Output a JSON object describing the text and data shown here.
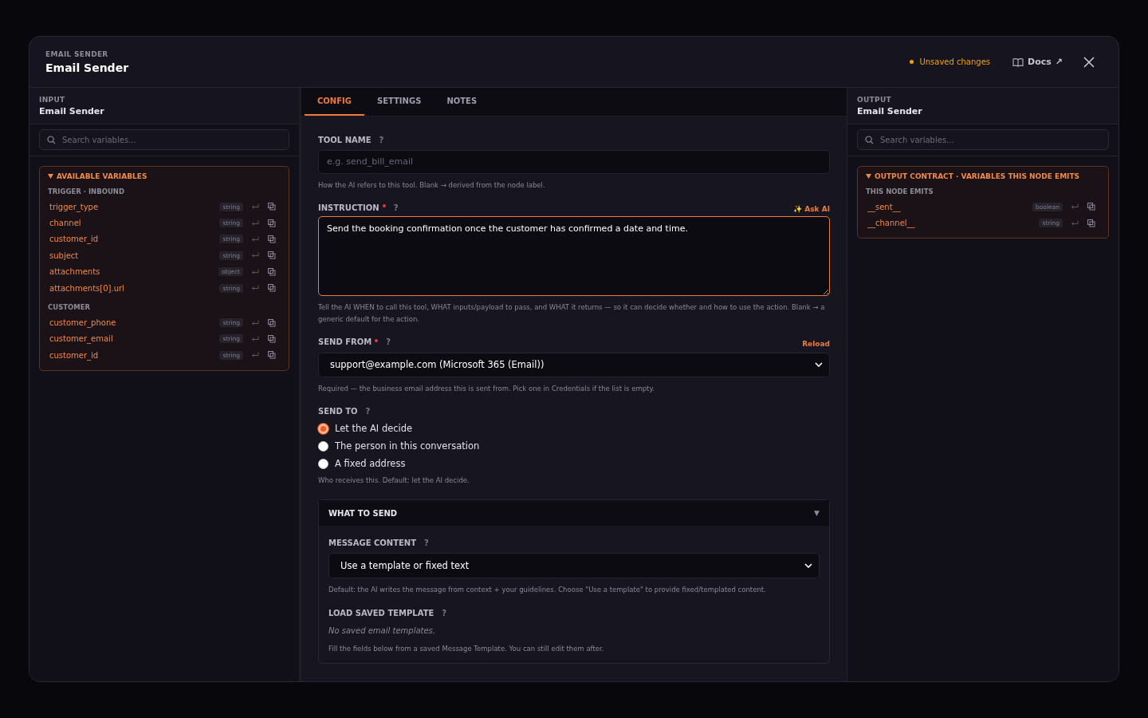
{
  "header": {
    "eyebrow": "EMAIL SENDER",
    "title": "Email Sender",
    "unsaved": "Unsaved changes",
    "docs": {
      "label": "Docs",
      "arrow": "↗"
    }
  },
  "input_panel": {
    "eyebrow": "INPUT",
    "title": "Email Sender",
    "search": {
      "placeholder": "Search variables..."
    },
    "section": {
      "title": "AVAILABLE VARIABLES",
      "expanded": true,
      "groups": [
        {
          "label": "TRIGGER · INBOUND",
          "vars": [
            {
              "name": "trigger_type",
              "type": "string"
            },
            {
              "name": "channel",
              "type": "string"
            },
            {
              "name": "customer_id",
              "type": "string"
            },
            {
              "name": "subject",
              "type": "string"
            },
            {
              "name": "attachments",
              "type": "object"
            },
            {
              "name": "attachments[0].url",
              "type": "string"
            }
          ]
        },
        {
          "label": "CUSTOMER",
          "vars": [
            {
              "name": "customer_phone",
              "type": "string"
            },
            {
              "name": "customer_email",
              "type": "string"
            },
            {
              "name": "customer_id",
              "type": "string"
            }
          ]
        }
      ]
    }
  },
  "tabs": [
    {
      "label": "CONFIG",
      "selected": true
    },
    {
      "label": "SETTINGS",
      "selected": false
    },
    {
      "label": "NOTES",
      "selected": false
    }
  ],
  "config": {
    "tool_name": {
      "label": "TOOL NAME",
      "help": "?",
      "placeholder": "e.g. send_bill_email",
      "hint": "How the AI refers to this tool. Blank → derived from the node label."
    },
    "instruction": {
      "label": "INSTRUCTION",
      "required": true,
      "help": "?",
      "ask_ai": "✨ Ask AI",
      "value": "Send the booking confirmation once the customer has confirmed a date and time.",
      "hint": "Tell the AI WHEN to call this tool, WHAT inputs/payload to pass, and WHAT it returns — so it can decide whether and how to use the action. Blank → a generic default for the action."
    },
    "send_from": {
      "label": "SEND FROM",
      "required": true,
      "help": "?",
      "reload": "Reload",
      "value": "support@example.com (Microsoft 365 (Email))",
      "hint": "Required — the business email address this is sent from. Pick one in Credentials if the list is empty."
    },
    "send_to": {
      "label": "SEND TO",
      "help": "?",
      "options": [
        {
          "label": "Let the AI decide",
          "selected": true
        },
        {
          "label": "The person in this conversation",
          "selected": false
        },
        {
          "label": "A fixed address",
          "selected": false
        }
      ],
      "hint": "Who receives this. Default: let the AI decide."
    },
    "what_to_send": {
      "title": "WHAT TO SEND",
      "expanded": true,
      "toggle": "▼",
      "message_content": {
        "label": "MESSAGE CONTENT",
        "help": "?",
        "value": "Use a template or fixed text",
        "hint": "Default: the AI writes the message from context + your guidelines. Choose \"Use a template\" to provide fixed/templated content."
      },
      "load_template": {
        "label": "LOAD SAVED TEMPLATE",
        "help": "?",
        "empty": "No saved email templates.",
        "hint": "Fill the fields below from a saved Message Template. You can still edit them after."
      }
    }
  },
  "output_panel": {
    "eyebrow": "OUTPUT",
    "title": "Email Sender",
    "search": {
      "placeholder": "Search variables..."
    },
    "section": {
      "title": "OUTPUT CONTRACT · VARIABLES THIS NODE EMITS",
      "expanded": true,
      "groups": [
        {
          "label": "THIS NODE EMITS",
          "vars": [
            {
              "name": "__sent__",
              "type": "boolean"
            },
            {
              "name": "__channel__",
              "type": "string"
            }
          ]
        }
      ]
    }
  }
}
